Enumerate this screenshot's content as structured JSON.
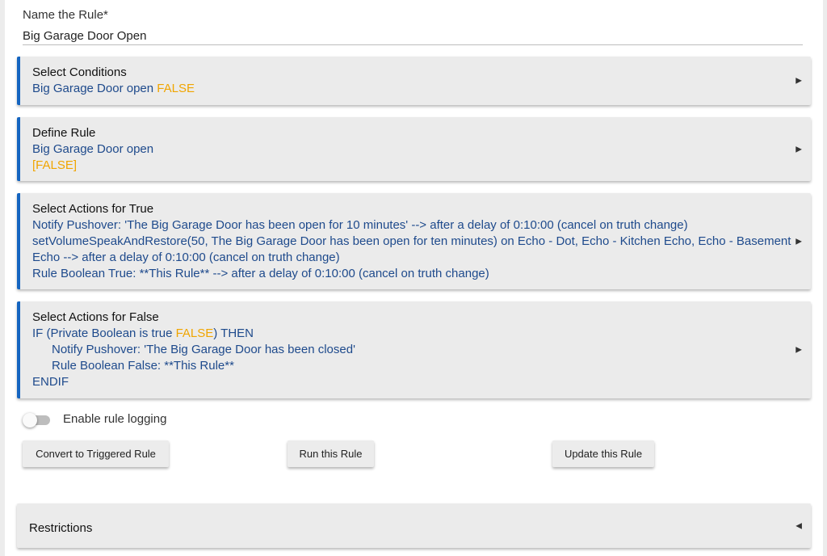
{
  "name_rule": {
    "label": "Name the Rule*",
    "value": "Big Garage Door Open"
  },
  "sections": {
    "conditions": {
      "title": "Select Conditions",
      "line_text": "Big Garage Door open ",
      "line_flag": "FALSE"
    },
    "define": {
      "title": "Define Rule",
      "line1": "Big Garage Door open",
      "line2": "[FALSE]"
    },
    "actions_true": {
      "title": "Select Actions for True",
      "lines": [
        "Notify Pushover: 'The Big Garage Door has been open for 10 minutes' --> after a delay of 0:10:00 (cancel on truth change)",
        "setVolumeSpeakAndRestore(50, The Big Garage Door has been open for ten minutes) on Echo - Dot, Echo - Kitchen Echo, Echo - Basement",
        "Echo --> after a delay of 0:10:00 (cancel on truth change)",
        "Rule Boolean True: **This Rule** --> after a delay of 0:10:00 (cancel on truth change)"
      ]
    },
    "actions_false": {
      "title": "Select Actions for False",
      "if_prefix": "IF (Private Boolean is true ",
      "if_flag": "FALSE",
      "if_suffix": ") THEN",
      "notify": "Notify Pushover: 'The Big Garage Door has been closed'",
      "boolean": "Rule Boolean False: **This Rule**",
      "endif": "ENDIF"
    },
    "arrow_collapsed": "▶",
    "arrow_expanded": "◀"
  },
  "logging": {
    "label": "Enable rule logging",
    "enabled": false
  },
  "buttons": {
    "convert": "Convert to Triggered Rule",
    "run": "Run this Rule",
    "update": "Update this Rule"
  },
  "restrictions": {
    "title": "Restrictions"
  },
  "colors": {
    "accent_border": "#1565c0",
    "link_text": "#1e4a8c",
    "highlight": "#f0a500",
    "card_bg": "#ebebeb"
  }
}
